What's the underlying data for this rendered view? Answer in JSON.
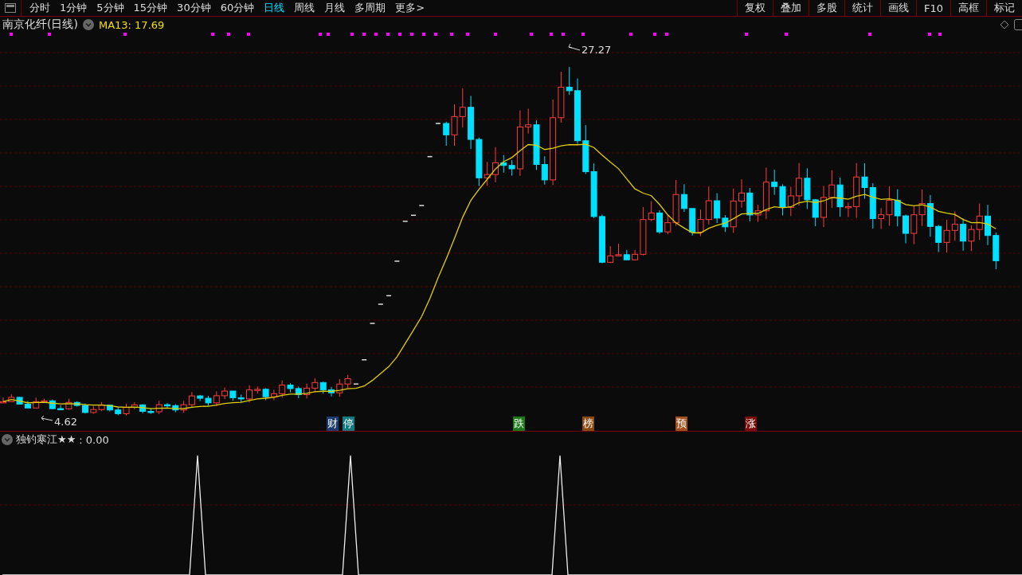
{
  "toolbar": {
    "periods": [
      {
        "label": "分时",
        "selected": false
      },
      {
        "label": "1分钟",
        "selected": false
      },
      {
        "label": "5分钟",
        "selected": false
      },
      {
        "label": "15分钟",
        "selected": false
      },
      {
        "label": "30分钟",
        "selected": false
      },
      {
        "label": "60分钟",
        "selected": false
      },
      {
        "label": "日线",
        "selected": true
      },
      {
        "label": "周线",
        "selected": false
      },
      {
        "label": "月线",
        "selected": false
      },
      {
        "label": "多周期",
        "selected": false
      },
      {
        "label": "更多>",
        "selected": false
      }
    ],
    "tools": [
      "复权",
      "叠加",
      "多股",
      "统计",
      "画线",
      "F10",
      "高框",
      "标记"
    ]
  },
  "chart": {
    "title": "南京化纤(日线)",
    "ma_label": "MA13: 17.69",
    "high_label": "27.27",
    "low_label": "4.62",
    "events": [
      {
        "label": "财",
        "color": "#1c3a6e"
      },
      {
        "label": "停",
        "color": "#137a80"
      },
      {
        "label": "跌",
        "color": "#1a7a1a"
      },
      {
        "label": "榜",
        "color": "#8a4a10"
      },
      {
        "label": "预",
        "color": "#a0501a"
      },
      {
        "label": "涨",
        "color": "#7a0a0a"
      }
    ]
  },
  "indicator": {
    "title": "独钓寒江★★",
    "value": ": 0.00"
  }
}
